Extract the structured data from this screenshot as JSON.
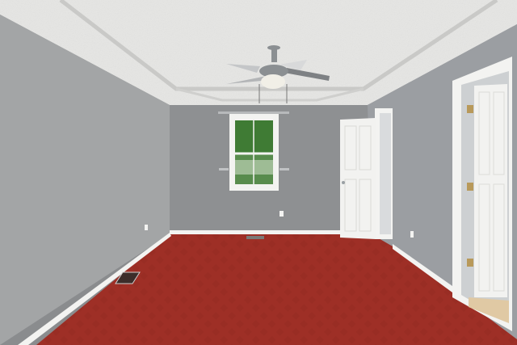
{
  "scene": {
    "kind": "interior-photo",
    "room": "empty bedroom",
    "colors": {
      "ceiling": "#e6e6e4",
      "wall_left": "#a3a5a6",
      "wall_back": "#8e9092",
      "wall_right": "#9b9ea2",
      "carpet": "#9e2f26",
      "carpet_pattern": "#7e211b",
      "trim": "#f3f3f1",
      "door": "#f2f2f0",
      "fan_metal": "#8b8f92",
      "window_foliage": "#3f7b34",
      "hall_floor": "#e0c9a4"
    },
    "objects": [
      "textured-tray-ceiling",
      "ceiling-fan-icon",
      "double-hung-window",
      "open-interior-door",
      "hallway-door",
      "floor-vent",
      "baseboard-trim",
      "red-patterned-carpet"
    ]
  }
}
